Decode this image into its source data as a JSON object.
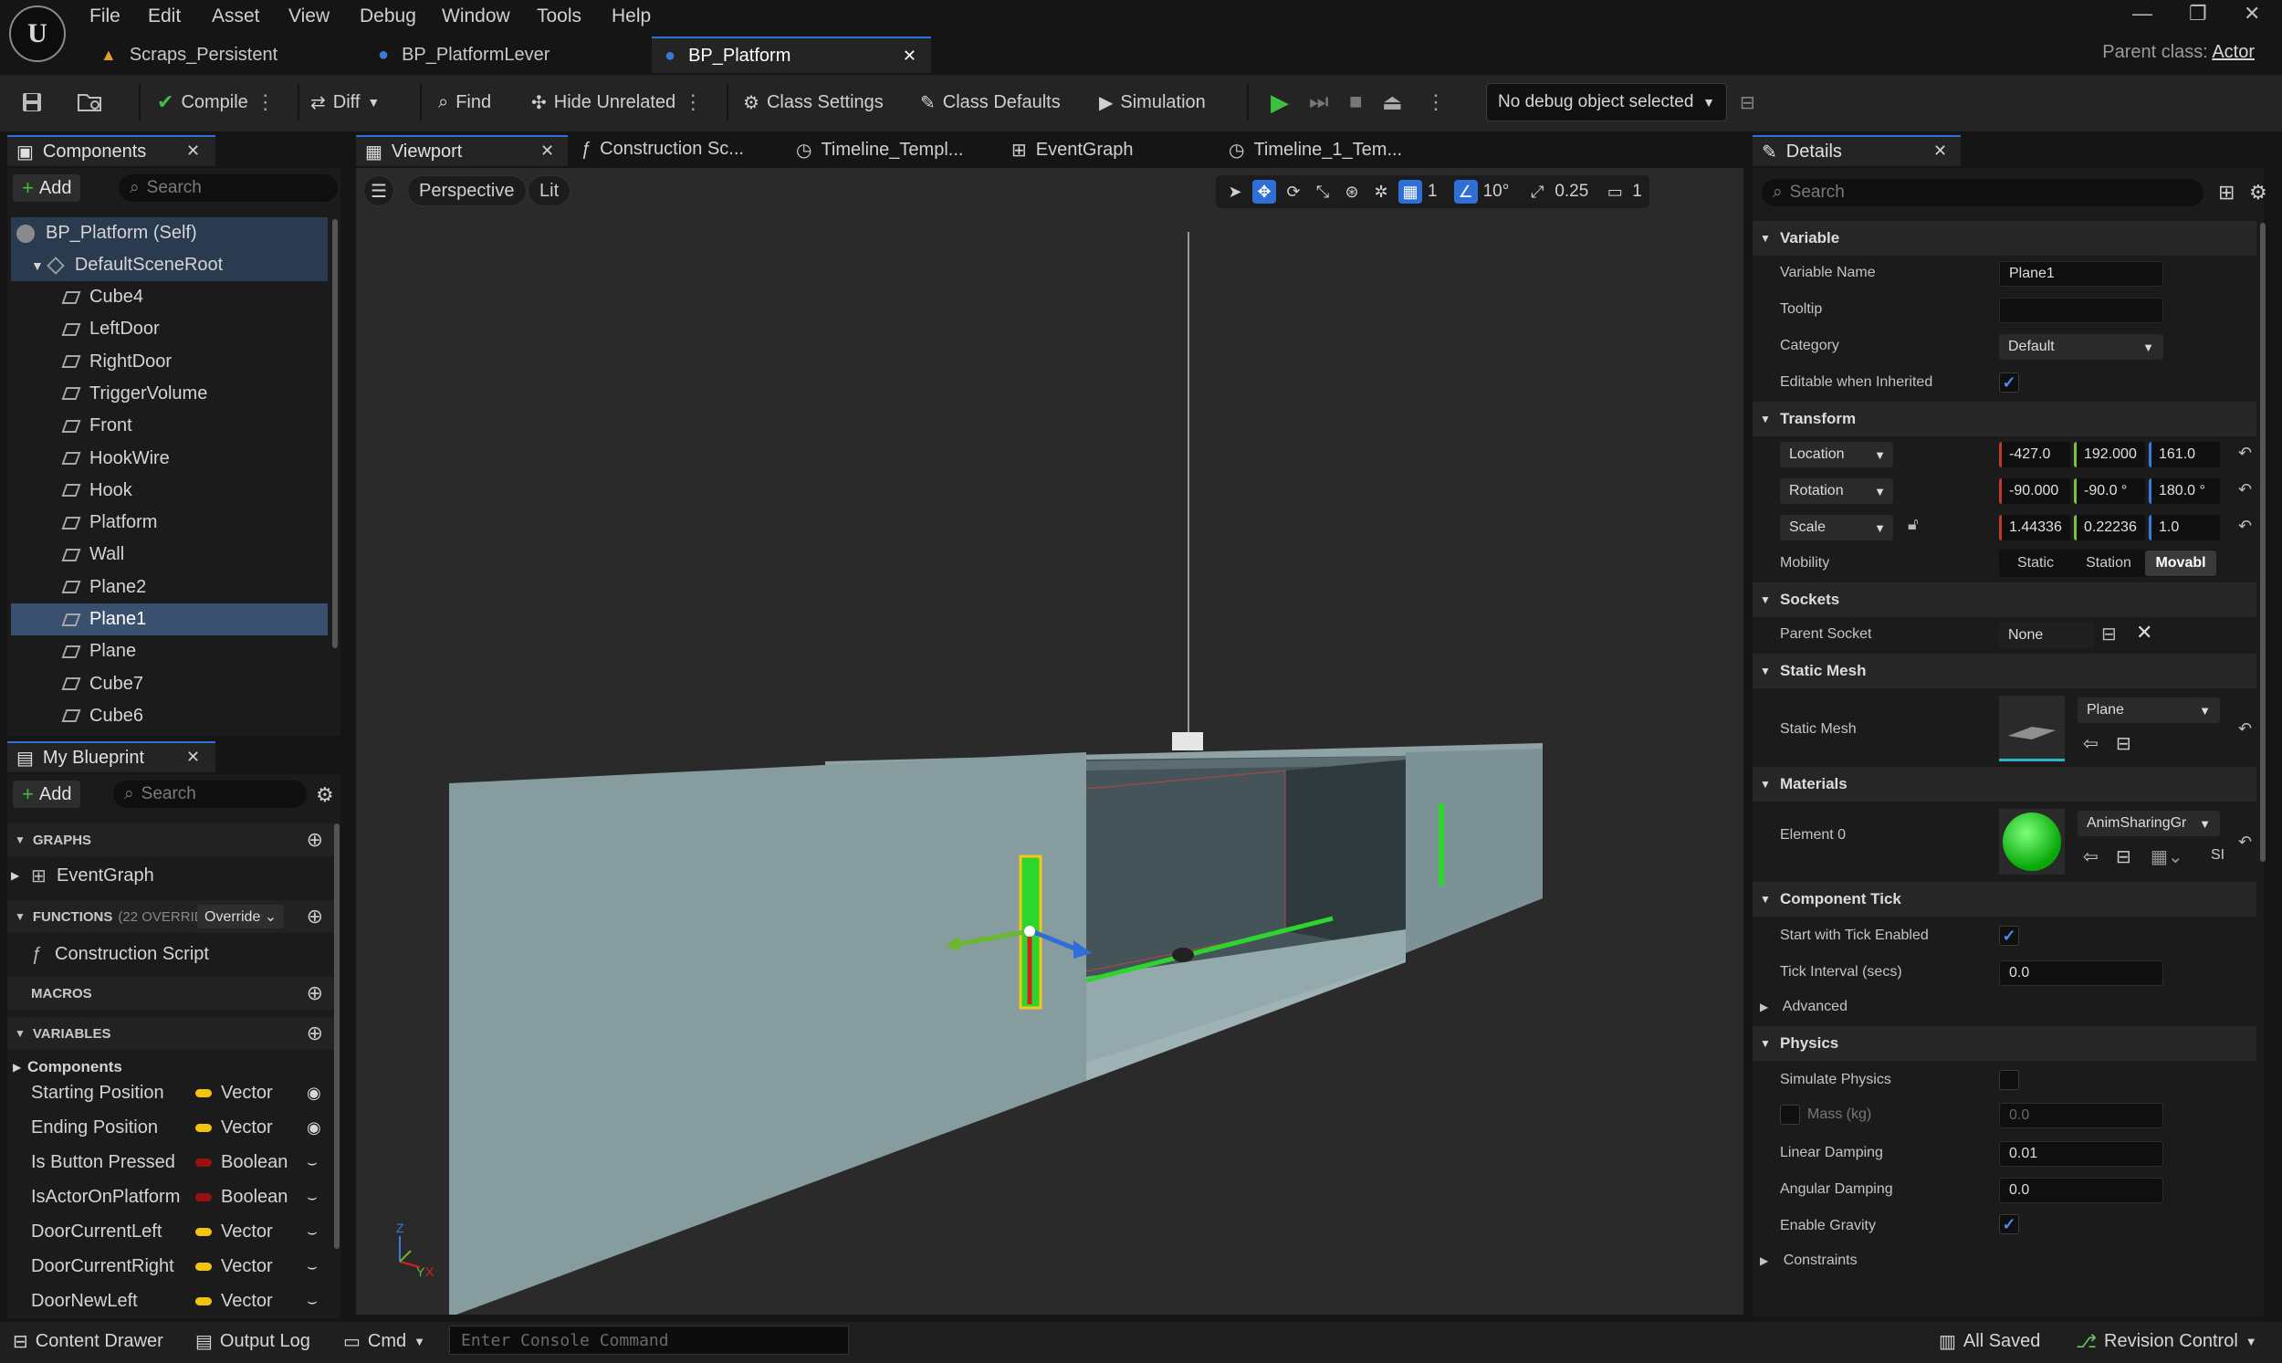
{
  "menu": [
    "File",
    "Edit",
    "Asset",
    "View",
    "Debug",
    "Window",
    "Tools",
    "Help"
  ],
  "doc_tabs": [
    {
      "label": "Scraps_Persistent",
      "active": false
    },
    {
      "label": "BP_PlatformLever",
      "active": false
    },
    {
      "label": "BP_Platform",
      "active": true
    }
  ],
  "parent_class": {
    "label": "Parent class:",
    "value": "Actor"
  },
  "toolbar": {
    "compile": "Compile",
    "diff": "Diff",
    "find": "Find",
    "hide_unrelated": "Hide Unrelated",
    "class_settings": "Class Settings",
    "class_defaults": "Class Defaults",
    "simulation": "Simulation",
    "debug_object": "No debug object selected"
  },
  "components": {
    "tab": "Components",
    "add": "Add",
    "search_placeholder": "Search",
    "root_self": "BP_Platform (Self)",
    "scene_root": "DefaultSceneRoot",
    "items": [
      "Cube4",
      "LeftDoor",
      "RightDoor",
      "TriggerVolume",
      "Front",
      "HookWire",
      "Hook",
      "Platform",
      "Wall",
      "Plane2",
      "Plane1",
      "Plane",
      "Cube7",
      "Cube6"
    ],
    "selected": "Plane1"
  },
  "my_blueprint": {
    "tab": "My Blueprint",
    "add": "Add",
    "search_placeholder": "Search",
    "graphs_header": "GRAPHS",
    "event_graph": "EventGraph",
    "functions_header": "FUNCTIONS",
    "functions_count": "(22 OVERRIDABLE)",
    "override": "Override",
    "construction_script": "Construction Script",
    "macros_header": "MACROS",
    "variables_header": "VARIABLES",
    "components_cat": "Components",
    "variables": [
      {
        "name": "Starting Position",
        "type": "Vector",
        "color": "#f2c40f",
        "visible": true
      },
      {
        "name": "Ending Position",
        "type": "Vector",
        "color": "#f2c40f",
        "visible": true
      },
      {
        "name": "Is Button Pressed",
        "type": "Boolean",
        "color": "#9a0f0f",
        "visible": false
      },
      {
        "name": "IsActorOnPlatform",
        "type": "Boolean",
        "color": "#9a0f0f",
        "visible": false
      },
      {
        "name": "DoorCurrentLeft",
        "type": "Vector",
        "color": "#f2c40f",
        "visible": false
      },
      {
        "name": "DoorCurrentRight",
        "type": "Vector",
        "color": "#f2c40f",
        "visible": false
      },
      {
        "name": "DoorNewLeft",
        "type": "Vector",
        "color": "#f2c40f",
        "visible": false
      }
    ]
  },
  "editor_tabs": [
    "Viewport",
    "Construction Sc...",
    "Timeline_Templ...",
    "EventGraph",
    "Timeline_1_Tem..."
  ],
  "viewport": {
    "perspective": "Perspective",
    "lit": "Lit",
    "grid_snap": "1",
    "rotation_snap": "10°",
    "scale_snap": "0.25",
    "camera_speed": "1"
  },
  "details": {
    "tab": "Details",
    "search_placeholder": "Search",
    "variable": {
      "header": "Variable",
      "name_label": "Variable Name",
      "name_value": "Plane1",
      "tooltip_label": "Tooltip",
      "tooltip_value": "",
      "category_label": "Category",
      "category_value": "Default",
      "editable_label": "Editable when Inherited",
      "editable_checked": true
    },
    "transform": {
      "header": "Transform",
      "location_label": "Location",
      "location": [
        "-427.0",
        "192.000",
        "161.0"
      ],
      "rotation_label": "Rotation",
      "rotation": [
        "-90.000",
        "-90.0 °",
        "180.0 °"
      ],
      "scale_label": "Scale",
      "scale": [
        "1.44336",
        "0.22236",
        "1.0"
      ],
      "mobility_label": "Mobility",
      "mobility_options": [
        "Static",
        "Station",
        "Movabl"
      ],
      "mobility_selected": "Movabl"
    },
    "sockets": {
      "header": "Sockets",
      "parent_socket_label": "Parent Socket",
      "parent_socket_value": "None"
    },
    "static_mesh": {
      "header": "Static Mesh",
      "label": "Static Mesh",
      "value": "Plane"
    },
    "materials": {
      "header": "Materials",
      "element_label": "Element 0",
      "value": "AnimSharingGr",
      "extra": "SI"
    },
    "component_tick": {
      "header": "Component Tick",
      "start_label": "Start with Tick Enabled",
      "start_checked": true,
      "interval_label": "Tick Interval (secs)",
      "interval_value": "0.0",
      "advanced": "Advanced"
    },
    "physics": {
      "header": "Physics",
      "simulate_label": "Simulate Physics",
      "simulate_checked": false,
      "mass_label": "Mass (kg)",
      "mass_value": "0.0",
      "linear_label": "Linear Damping",
      "linear_value": "0.01",
      "angular_label": "Angular Damping",
      "angular_value": "0.0",
      "gravity_label": "Enable Gravity",
      "gravity_checked": true,
      "constraints": "Constraints"
    }
  },
  "status": {
    "content_drawer": "Content Drawer",
    "output_log": "Output Log",
    "cmd": "Cmd",
    "console_placeholder": "Enter Console Command",
    "all_saved": "All Saved",
    "revision_control": "Revision Control"
  },
  "colors": {
    "accent": "#2d6fd6",
    "selected_row": "#39506e",
    "vector_pin": "#f2c40f",
    "bool_pin": "#9a0f0f"
  }
}
